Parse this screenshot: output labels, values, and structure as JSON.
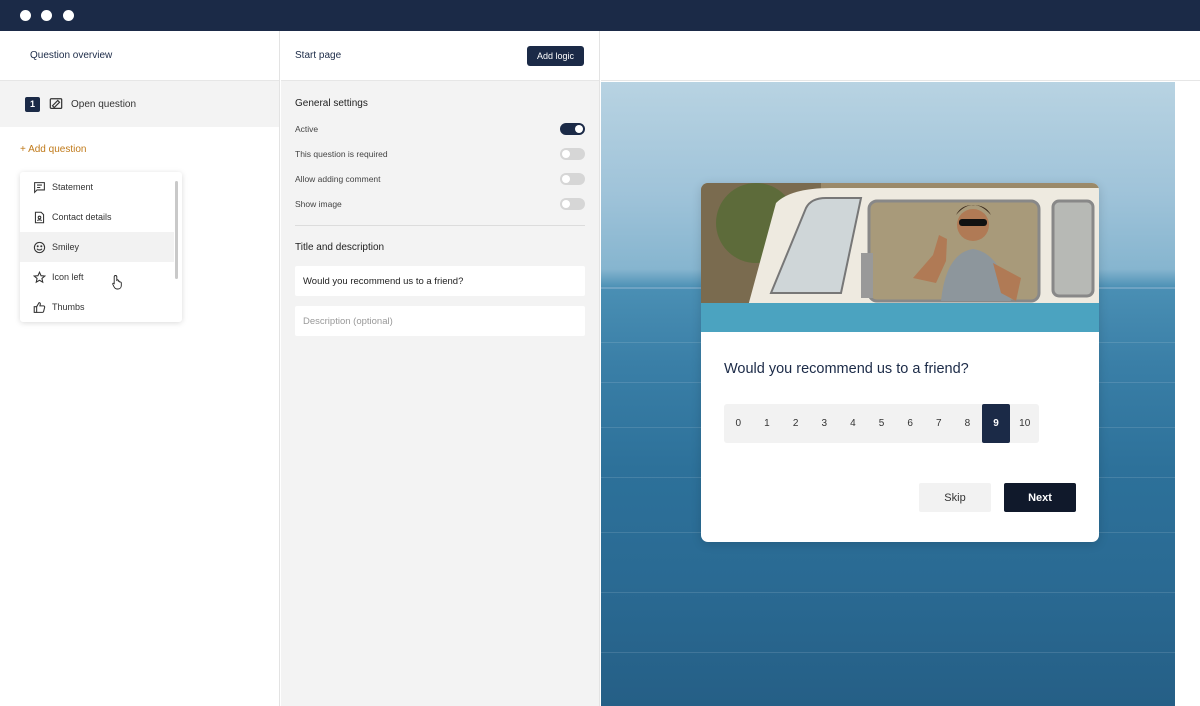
{
  "window": {
    "controls": [
      "close",
      "minimize",
      "maximize"
    ]
  },
  "left_panel": {
    "title": "Question overview",
    "questions": [
      {
        "number": "1",
        "icon": "open-question-icon",
        "label": "Open question"
      }
    ],
    "add_question_label": "+ Add question",
    "question_types": [
      {
        "icon": "statement-icon",
        "label": "Statement"
      },
      {
        "icon": "contact-details-icon",
        "label": "Contact details"
      },
      {
        "icon": "smiley-icon",
        "label": "Smiley",
        "hovered": true
      },
      {
        "icon": "star-icon",
        "label": "Icon left"
      },
      {
        "icon": "thumbs-up-icon",
        "label": "Thumbs"
      }
    ]
  },
  "middle_panel": {
    "title": "Start page",
    "add_logic_label": "Add logic",
    "general_settings": {
      "title": "General settings",
      "items": [
        {
          "label": "Active",
          "on": true
        },
        {
          "label": "This question is required",
          "on": false
        },
        {
          "label": "Allow adding comment",
          "on": false
        },
        {
          "label": "Show image",
          "on": false
        }
      ]
    },
    "title_description": {
      "title": "Title and description",
      "title_value": "Would you recommend us to a friend?",
      "description_placeholder": "Description (optional)"
    }
  },
  "preview": {
    "question": "Would you recommend us to a friend?",
    "scale": [
      "0",
      "1",
      "2",
      "3",
      "4",
      "5",
      "6",
      "7",
      "8",
      "9",
      "10"
    ],
    "selected": "9",
    "skip_label": "Skip",
    "next_label": "Next",
    "colors": {
      "primary": "#1b2a47",
      "accent": "#c07a1a"
    }
  }
}
